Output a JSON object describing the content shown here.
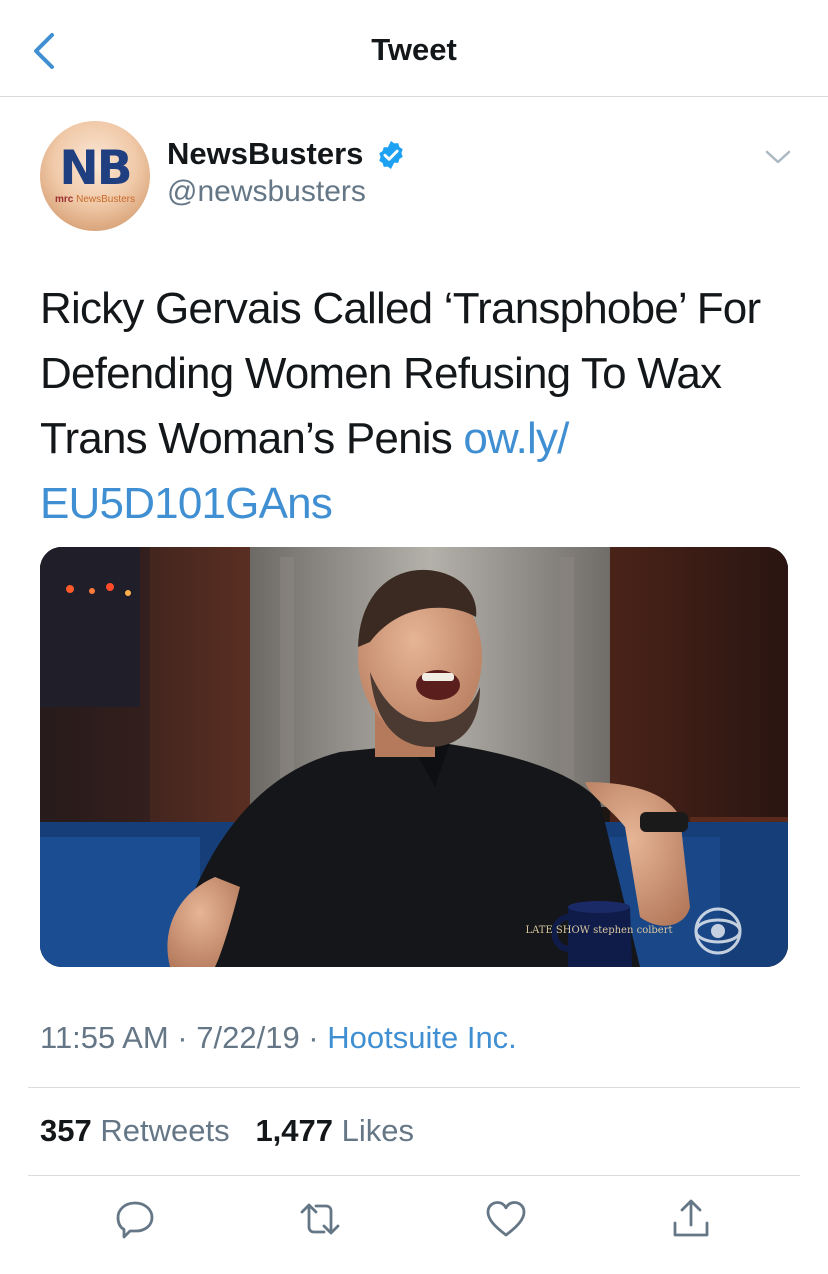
{
  "nav": {
    "title": "Tweet",
    "back_icon": "chevron-left-icon"
  },
  "author": {
    "display_name": "NewsBusters",
    "handle": "@newsbusters",
    "verified": true,
    "avatar_logo": "NB",
    "avatar_sub_prefix": "mrc",
    "avatar_sub_brand": "NewsBusters"
  },
  "tweet": {
    "text": "Ricky Gervais Called ‘Transphobe’ For Defending Women Refusing To Wax Trans Woman’s Penis ",
    "link": "ow.ly/ EU5D101GAns",
    "media_overlay": {
      "mug_text": "LATE SHOW stephen colbert",
      "network_icon": "cbs-eye-logo"
    }
  },
  "meta": {
    "time": "11:55 AM",
    "sep1": " · ",
    "date": "7/22/19",
    "sep2": " · ",
    "source": "Hootsuite Inc."
  },
  "stats": {
    "retweets_count": "357",
    "retweets_label": "Retweets",
    "likes_count": "1,477",
    "likes_label": "Likes"
  },
  "actions": [
    "reply-icon",
    "retweet-icon",
    "like-icon",
    "share-icon"
  ],
  "colors": {
    "link": "#3f8fd2",
    "secondary_text": "#657786",
    "verified": "#1da1f2",
    "primary_text": "#14171a"
  }
}
